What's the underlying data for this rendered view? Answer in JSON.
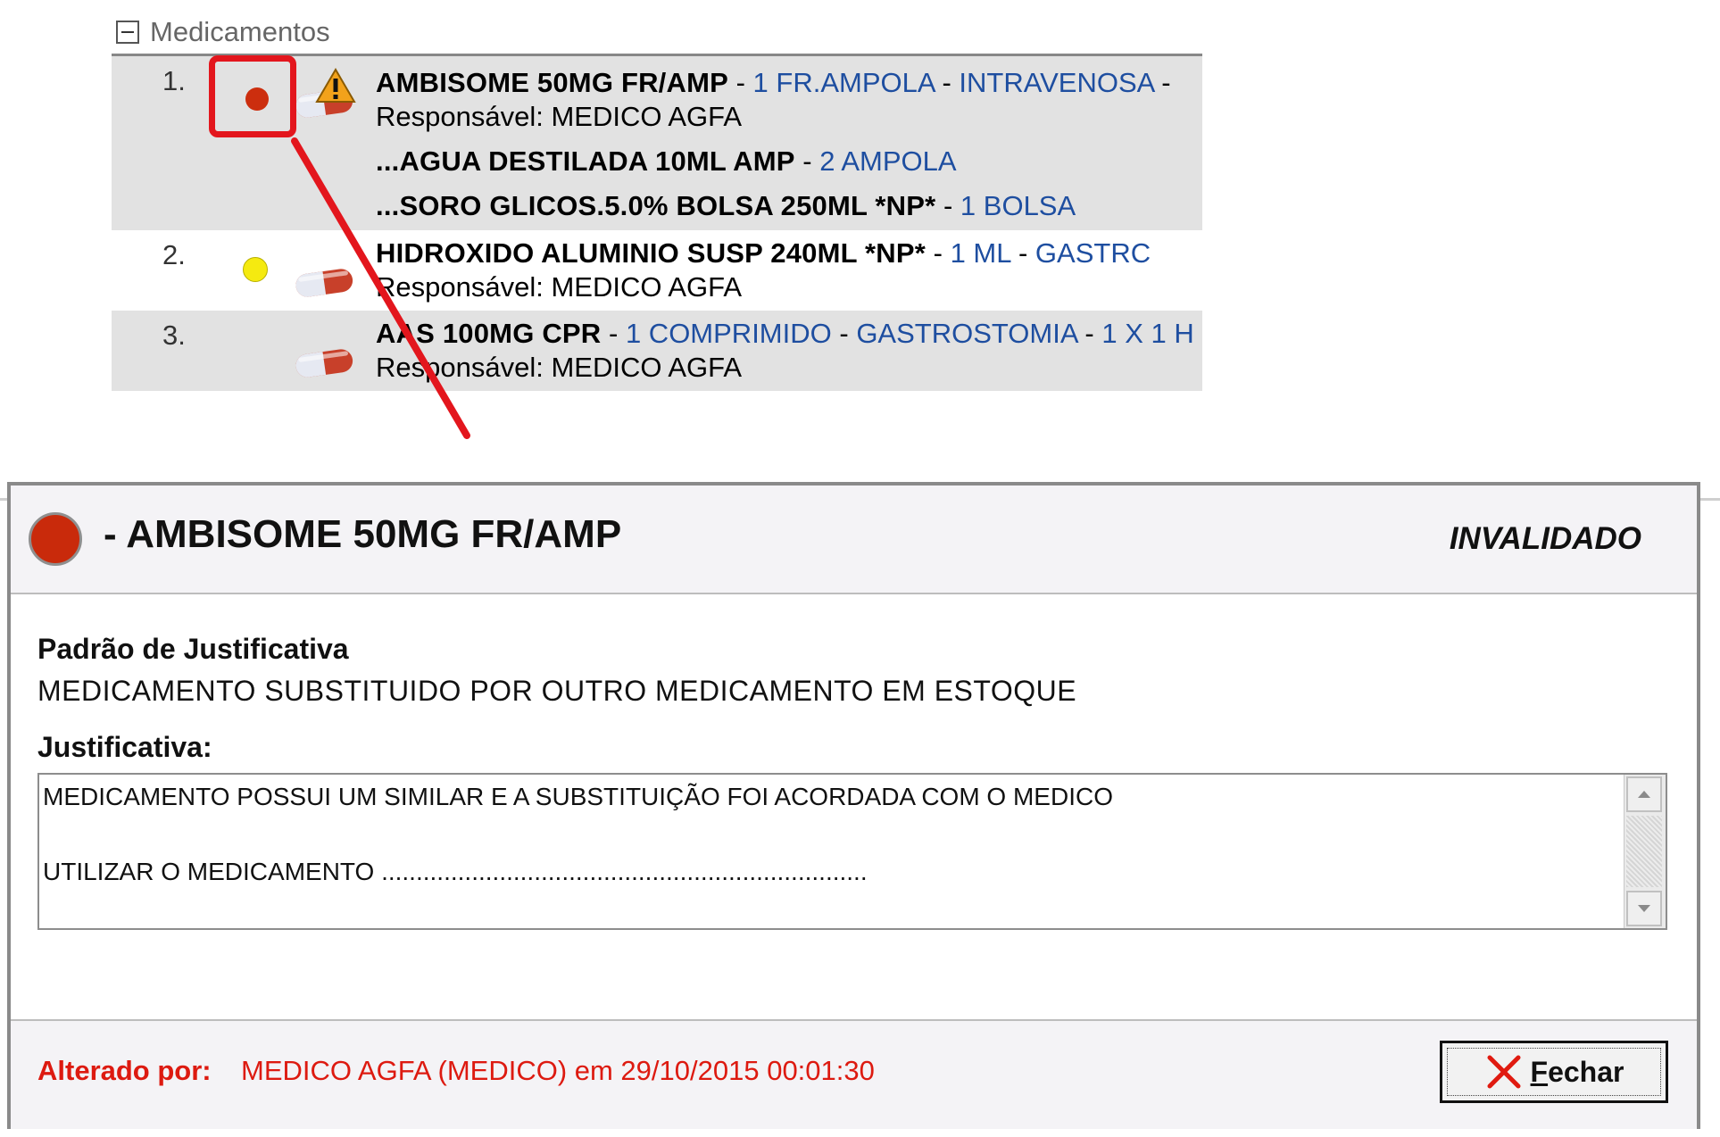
{
  "section": {
    "title": "Medicamentos"
  },
  "medications": [
    {
      "number": "1.",
      "status_color": "#cc2e0e",
      "warning": true,
      "name": "AMBISOME 50MG FR/AMP",
      "dose": "1 FR.AMPOLA",
      "route": "INTRAVENOSA",
      "responsible": "Responsável: MEDICO AGFA",
      "diluents": [
        {
          "name": "...AGUA DESTILADA 10ML AMP",
          "qty": "2 AMPOLA"
        },
        {
          "name": "...SORO GLICOS.5.0% BOLSA 250ML *NP*",
          "qty": "1 BOLSA"
        }
      ]
    },
    {
      "number": "2.",
      "status_color": "#f5ea10",
      "name": "HIDROXIDO ALUMINIO SUSP 240ML *NP*",
      "dose": "1 ML",
      "route": "GASTRC",
      "responsible": "Responsável: MEDICO AGFA"
    },
    {
      "number": "3.",
      "name": "AAS 100MG CPR",
      "dose": "1 COMPRIMIDO",
      "route": "GASTROSTOMIA",
      "frequency": "1 X 1 H",
      "responsible": "Responsável: MEDICO AGFA"
    }
  ],
  "sep": " - ",
  "dialog": {
    "title": "- AMBISOME 50MG FR/AMP",
    "status": "INVALIDADO",
    "padrao_label": "Padrão de Justificativa",
    "padrao_value": "MEDICAMENTO SUBSTITUIDO POR OUTRO MEDICAMENTO EM ESTOQUE",
    "justificativa_label": "Justificativa:",
    "justificativa_text": "MEDICAMENTO POSSUI UM SIMILAR E A SUBSTITUIÇÃO FOI ACORDADA COM O MEDICO\n\nUTILIZAR O MEDICAMENTO ......................................................................",
    "altered_label": "Alterado por:",
    "altered_value": "MEDICO AGFA (MEDICO) em 29/10/2015 00:01:30",
    "close_mnemonic": "F",
    "close_rest": "echar"
  },
  "colors": {
    "accent_red": "#dd1a10",
    "link_blue": "#1e4ea0",
    "status_red": "#c92a0b",
    "status_yellow": "#f5ea10"
  },
  "icons": [
    "collapse-minus-icon",
    "status-red-dot-icon",
    "warning-triangle-icon",
    "pill-capsule-icon",
    "status-yellow-dot-icon",
    "close-x-icon"
  ]
}
